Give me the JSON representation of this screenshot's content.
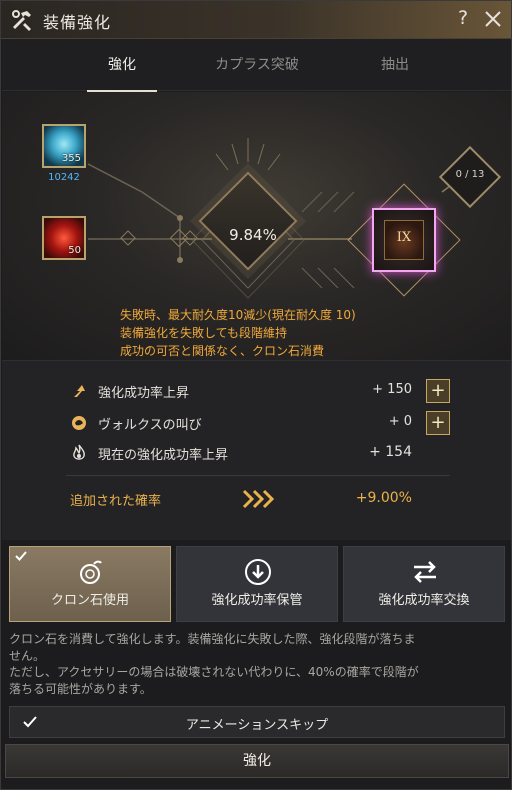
{
  "window": {
    "title": "装備強化",
    "help": "?"
  },
  "tabs": [
    {
      "label": "強化",
      "active": true
    },
    {
      "label": "カプラス突破",
      "active": false
    },
    {
      "label": "抽出",
      "active": false
    }
  ],
  "scene": {
    "material1": {
      "qty": "355",
      "count": "10242"
    },
    "material2": {
      "qty": "50"
    },
    "success_rate": "9.84%",
    "target_grade": "IX",
    "counter": "0 / 13",
    "warnings": [
      "失敗時、最大耐久度10減少(現在耐久度 10)",
      "装備強化を失敗しても段階維持",
      "成功の可否と関係なく、クロン石消費"
    ]
  },
  "stats": [
    {
      "label": "強化成功率上昇",
      "value": "+ 150",
      "icon": "arrow-up-icon"
    },
    {
      "label": "ヴォルクスの叫び",
      "value": "+ 0",
      "icon": "vorx-cry-icon"
    },
    {
      "label": "現在の強化成功率上昇",
      "value": "+ 154",
      "icon": "flame-icon"
    }
  ],
  "added": {
    "label": "追加された確率",
    "value": "+9.00%"
  },
  "options": [
    {
      "label": "クロン石使用",
      "checked": true
    },
    {
      "label": "強化成功率保管"
    },
    {
      "label": "強化成功率交換"
    }
  ],
  "description": {
    "line1": "クロン石を消費して強化します。装備強化に失敗した際、強化段階が落ちま",
    "line2": "せん。",
    "line3": "ただし、アクセサリーの場合は破壊されない代わりに、40%の確率で段階が",
    "line4": "落ちる可能性があります。"
  },
  "animation_skip": {
    "label": "アニメーションスキップ",
    "checked": true
  },
  "upgrade_button": "強化",
  "colors": {
    "accent_gold": "#e9b24a",
    "warning_orange": "#f0a93a",
    "count_blue": "#4fb8ff",
    "grade_glow": "#d455c9"
  }
}
